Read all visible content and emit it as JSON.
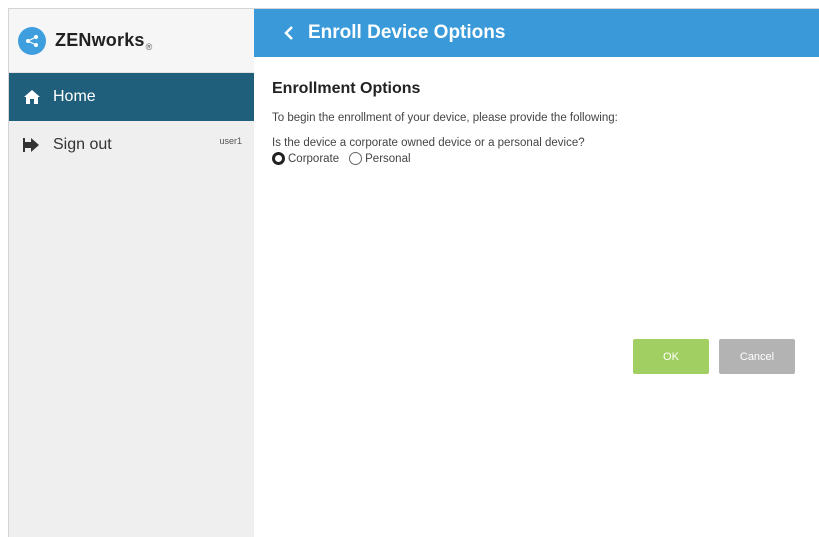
{
  "brand": {
    "name": "ZENworks",
    "reg": "®"
  },
  "sidebar": {
    "items": [
      {
        "label": "Home",
        "icon": "home-icon"
      },
      {
        "label": "Sign out",
        "icon": "sign-out-icon",
        "user": "user1"
      }
    ]
  },
  "header": {
    "title": "Enroll Device Options",
    "back_icon": "chevron-left-icon"
  },
  "content": {
    "section_title": "Enrollment Options",
    "intro": "To begin the enrollment of your device, please provide the following:",
    "question": "Is the device a corporate owned device or a personal device?",
    "options": [
      {
        "label": "Corporate",
        "selected": true
      },
      {
        "label": "Personal",
        "selected": false
      }
    ]
  },
  "buttons": {
    "ok_label": "OK",
    "cancel_label": "Cancel"
  },
  "colors": {
    "header": "#3a9ad9",
    "nav_active": "#1f5f7b",
    "ok": "#a2cf62",
    "cancel": "#b3b3b3"
  }
}
